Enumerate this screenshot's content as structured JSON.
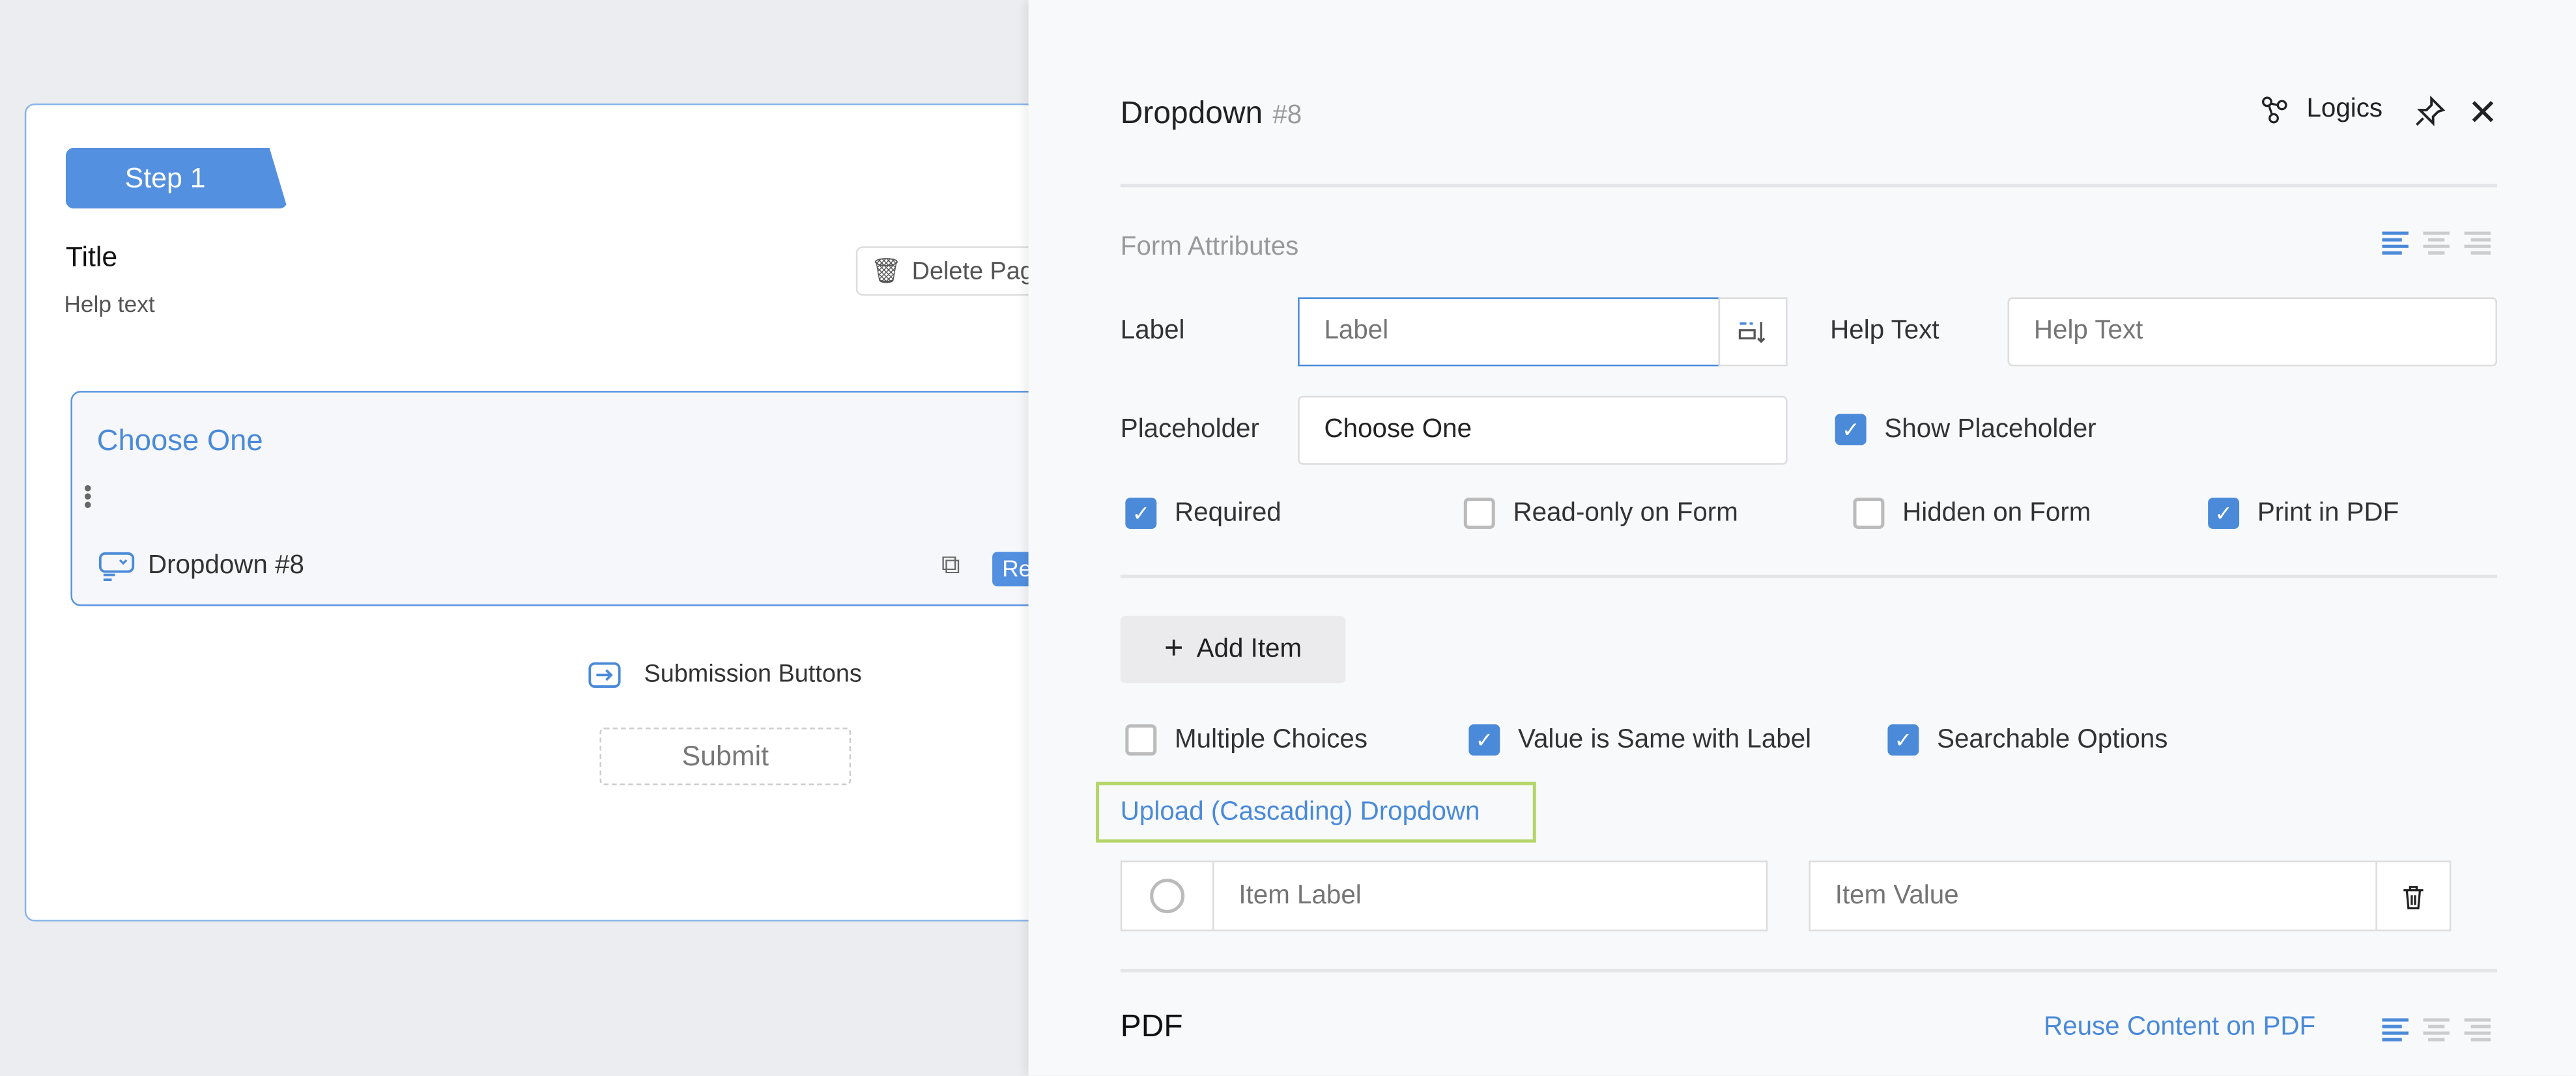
{
  "canvas": {
    "step_label": "Step 1",
    "title": "Title",
    "help_text": "Help text",
    "delete_page": "Delete Page",
    "field": {
      "placeholder_preview": "Choose One",
      "type_label": "Dropdown #8",
      "action_button": "Re"
    },
    "submission_buttons": "Submission Buttons",
    "submit": "Submit"
  },
  "panel": {
    "title": "Dropdown",
    "id": "#8",
    "logics": "Logics",
    "section_form_attributes": "Form Attributes",
    "label": {
      "label": "Label",
      "placeholder": "Label",
      "value": ""
    },
    "help_text": {
      "label": "Help Text",
      "placeholder": "Help Text",
      "value": ""
    },
    "placeholder": {
      "label": "Placeholder",
      "value": "Choose One"
    },
    "show_placeholder": {
      "label": "Show Placeholder",
      "checked": true
    },
    "options": [
      {
        "label": "Required",
        "checked": true
      },
      {
        "label": "Read-only on Form",
        "checked": false
      },
      {
        "label": "Hidden on Form",
        "checked": false
      },
      {
        "label": "Print in PDF",
        "checked": true
      }
    ],
    "add_item": "Add Item",
    "item_options": [
      {
        "label": "Multiple Choices",
        "checked": false
      },
      {
        "label": "Value is Same with Label",
        "checked": true
      },
      {
        "label": "Searchable Options",
        "checked": true
      }
    ],
    "upload_link": "Upload (Cascading) Dropdown",
    "item_row": {
      "label_placeholder": "Item Label",
      "value_placeholder": "Item Value"
    },
    "pdf_section": "PDF",
    "reuse_link": "Reuse Content on PDF"
  },
  "colors": {
    "accent": "#4a8ad8",
    "highlight": "#b5d56a"
  }
}
